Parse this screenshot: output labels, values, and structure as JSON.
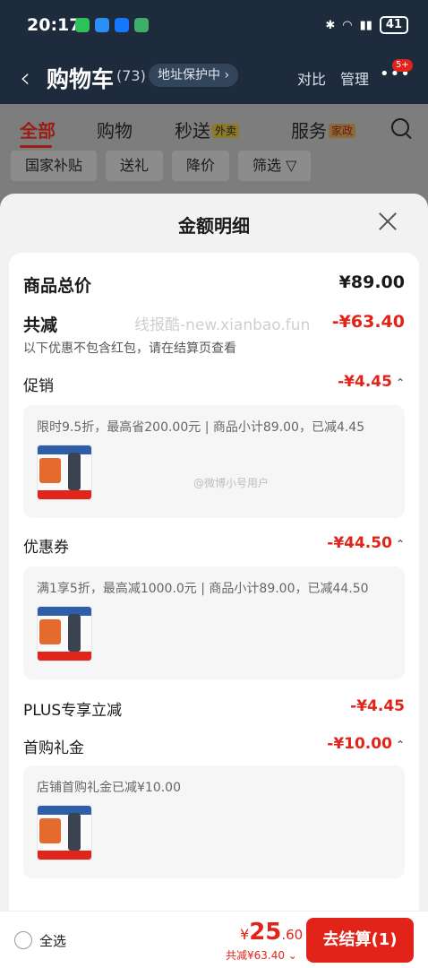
{
  "status_bar": {
    "time": "20:17",
    "battery": "41"
  },
  "header": {
    "back_icon": "‹",
    "title": "购物车",
    "count": "(73)",
    "address_protect": "地址保护中 ›",
    "compare": "对比",
    "manage": "管理",
    "more_icon": "•••",
    "badge": "5+"
  },
  "tabs": [
    {
      "label": "全部"
    },
    {
      "label": "购物"
    },
    {
      "label": "秒送",
      "tag": "外卖"
    },
    {
      "label": "服务",
      "tag": "家政"
    }
  ],
  "chips": [
    "国家补贴",
    "送礼",
    "降价",
    "筛选 ▽"
  ],
  "sheet": {
    "title": "金额明细",
    "total": {
      "label": "商品总价",
      "value": "¥89.00"
    },
    "discount": {
      "label": "共减",
      "value": "-¥63.40",
      "note": "以下优惠不包含红包，请在结算页查看"
    },
    "watermark": "线报酷-new.xianbao.fun",
    "promo": {
      "label": "促销",
      "value": "-¥4.45",
      "detail": "限时9.5折，最高省200.00元 | 商品小计89.00，已减4.45"
    },
    "coupon": {
      "label": "优惠券",
      "value": "-¥44.50",
      "detail": "满1享5折，最高减1000.0元 | 商品小计89.00，已减44.50"
    },
    "plus": {
      "label": "PLUS专享立减",
      "value": "-¥4.45"
    },
    "first": {
      "label": "首购礼金",
      "value": "-¥10.00",
      "detail": "店铺首购礼金已减¥10.00"
    },
    "weibo_mark": "@微博小号用户"
  },
  "bottom": {
    "select_all": "全选",
    "price_currency": "¥",
    "price_int": "25",
    "price_dec": ".60",
    "saved": "共减¥63.40 ⌄",
    "checkout": "去结算(1)"
  },
  "colors": {
    "accent": "#e2231a",
    "header_bg": "#1e2b3c"
  }
}
